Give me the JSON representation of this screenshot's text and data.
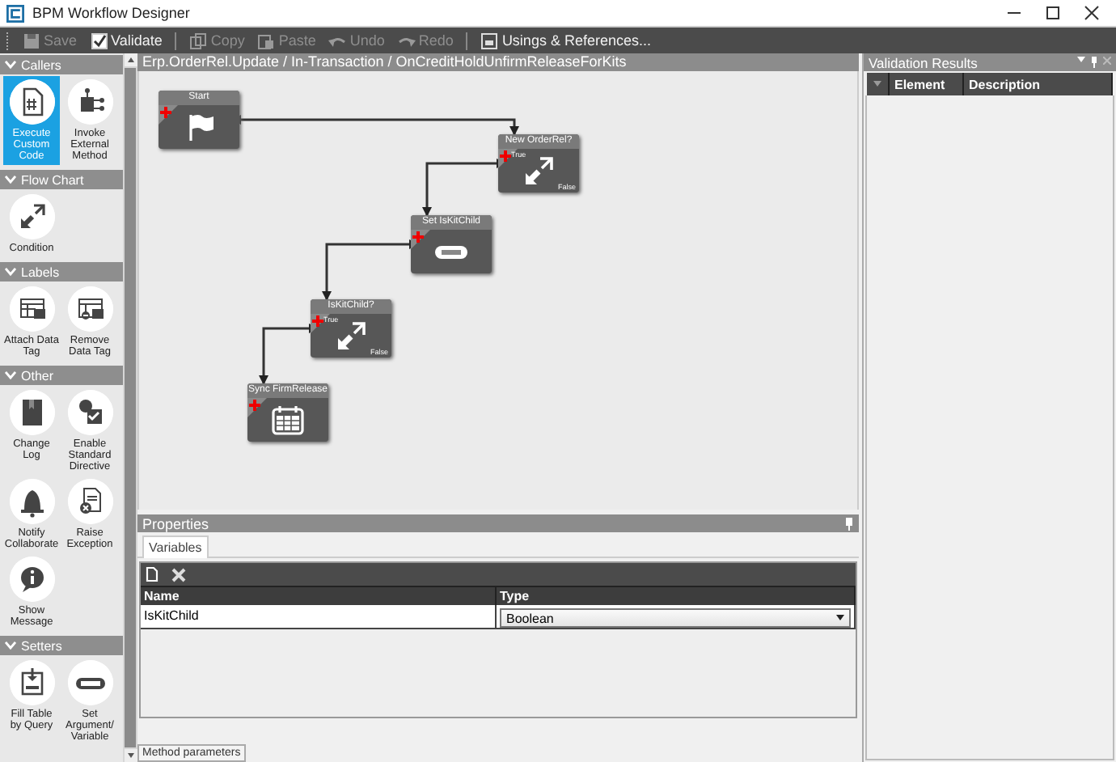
{
  "window": {
    "title": "BPM Workflow Designer"
  },
  "toolbar": {
    "groups": [
      [
        {
          "label": "Save",
          "disabled": true
        },
        {
          "label": "Validate",
          "disabled": false
        }
      ],
      [
        {
          "label": "Copy",
          "disabled": true
        },
        {
          "label": "Paste",
          "disabled": true
        },
        {
          "label": "Undo",
          "disabled": true
        },
        {
          "label": "Redo",
          "disabled": true
        }
      ],
      [
        {
          "label": "Usings & References...",
          "disabled": false
        }
      ]
    ]
  },
  "toolbox": {
    "sections": [
      {
        "title": "Callers",
        "expanded": true,
        "items": [
          {
            "label": "Execute Custom Code",
            "selected": true
          },
          {
            "label": "Invoke External Method",
            "selected": false
          }
        ]
      },
      {
        "title": "Flow Chart",
        "expanded": true,
        "items": [
          {
            "label": "Condition",
            "selected": false
          }
        ]
      },
      {
        "title": "Labels",
        "expanded": true,
        "items": [
          {
            "label": "Attach Data Tag",
            "selected": false
          },
          {
            "label": "Remove Data Tag",
            "selected": false
          }
        ]
      },
      {
        "title": "Other",
        "expanded": true,
        "items": [
          {
            "label": "Change Log",
            "selected": false
          },
          {
            "label": "Enable Standard Directive",
            "selected": false
          },
          {
            "label": "Notify Collaborate",
            "selected": false
          },
          {
            "label": "Raise Exception",
            "selected": false
          },
          {
            "label": "Show Message",
            "selected": false
          }
        ]
      },
      {
        "title": "Setters",
        "expanded": true,
        "items": [
          {
            "label": "Fill Table by Query",
            "selected": false
          },
          {
            "label": "Set Argument/ Variable",
            "selected": false
          }
        ]
      }
    ]
  },
  "canvas": {
    "breadcrumb": "Erp.OrderRel.Update / In-Transaction / OnCreditHoldUnfirmReleaseForKits",
    "nodes": [
      {
        "title": "Start",
        "kind": "start"
      },
      {
        "title": "New OrderRel?",
        "kind": "condition",
        "true_label": "True",
        "false_label": "False"
      },
      {
        "title": "Set IsKitChild",
        "kind": "setter"
      },
      {
        "title": "IsKitChild?",
        "kind": "condition",
        "true_label": "True",
        "false_label": "False"
      },
      {
        "title": "Sync FirmRelease",
        "kind": "calendar"
      }
    ]
  },
  "properties": {
    "title": "Properties",
    "tabs": [
      {
        "label": "Variables",
        "selected": true
      }
    ],
    "columns": [
      "Name",
      "Type"
    ],
    "rows": [
      {
        "name": "IsKitChild",
        "type": "Boolean"
      }
    ]
  },
  "bottom_tabs": [
    {
      "label": "Method parameters"
    }
  ],
  "validation": {
    "title": "Validation Results",
    "columns": [
      "Element",
      "Description"
    ]
  }
}
